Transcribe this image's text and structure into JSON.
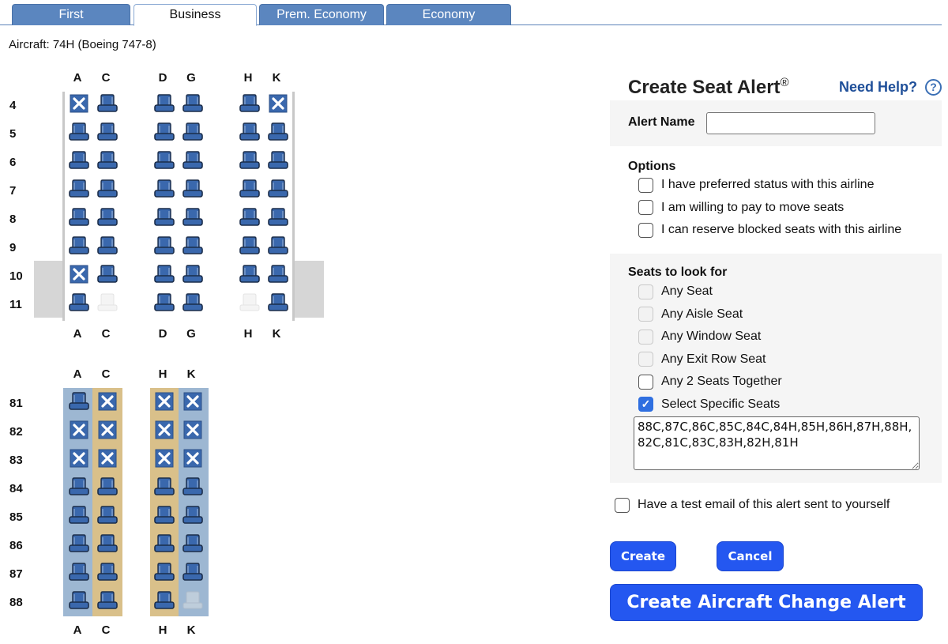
{
  "tabs": [
    {
      "label": "First",
      "active": false
    },
    {
      "label": "Business",
      "active": true
    },
    {
      "label": "Prem. Economy",
      "active": false
    },
    {
      "label": "Economy",
      "active": false
    }
  ],
  "aircraft_label": "Aircraft: 74H (Boeing 747-8)",
  "seatmap": {
    "upper_deck": {
      "columns": [
        "A",
        "C",
        "D",
        "G",
        "H",
        "K"
      ],
      "rows": [
        {
          "row": "4",
          "seats": [
            "blocked",
            "available",
            "available",
            "available",
            "available",
            "blocked"
          ]
        },
        {
          "row": "5",
          "seats": [
            "available",
            "available",
            "available",
            "available",
            "available",
            "available"
          ]
        },
        {
          "row": "6",
          "seats": [
            "available",
            "available",
            "available",
            "available",
            "available",
            "available"
          ]
        },
        {
          "row": "7",
          "seats": [
            "available",
            "available",
            "available",
            "available",
            "available",
            "available"
          ]
        },
        {
          "row": "8",
          "seats": [
            "available",
            "available",
            "available",
            "available",
            "available",
            "available"
          ]
        },
        {
          "row": "9",
          "seats": [
            "available",
            "available",
            "available",
            "available",
            "available",
            "available"
          ]
        },
        {
          "row": "10",
          "seats": [
            "blocked",
            "available",
            "available",
            "available",
            "available",
            "available"
          ]
        },
        {
          "row": "11",
          "seats": [
            "available",
            "empty",
            "available",
            "available",
            "empty",
            "available"
          ]
        }
      ],
      "exit_rows": [
        "10",
        "11"
      ]
    },
    "lower_deck": {
      "columns": [
        "A",
        "C",
        "H",
        "K"
      ],
      "rows": [
        {
          "row": "81",
          "seats": [
            "available",
            "blocked",
            "blocked",
            "blocked"
          ]
        },
        {
          "row": "82",
          "seats": [
            "blocked",
            "blocked",
            "blocked",
            "blocked"
          ]
        },
        {
          "row": "83",
          "seats": [
            "blocked",
            "blocked",
            "blocked",
            "blocked"
          ]
        },
        {
          "row": "84",
          "seats": [
            "available",
            "available",
            "available",
            "available"
          ]
        },
        {
          "row": "85",
          "seats": [
            "available",
            "available",
            "available",
            "available"
          ]
        },
        {
          "row": "86",
          "seats": [
            "available",
            "available",
            "available",
            "available"
          ]
        },
        {
          "row": "87",
          "seats": [
            "available",
            "available",
            "available",
            "available"
          ]
        },
        {
          "row": "88",
          "seats": [
            "available",
            "available",
            "available",
            "empty"
          ]
        }
      ],
      "column_highlights": [
        "window",
        "aisle",
        "aisle",
        "window"
      ]
    },
    "colors": {
      "seat": "#3a68ad",
      "seat_dark": "#1b2d4a",
      "window_band": "#9db7d2",
      "aisle_band": "#d9c08a",
      "exit": "#d6d6d6"
    }
  },
  "panel": {
    "title": "Create Seat Alert",
    "title_mark": "®",
    "help_label": "Need Help?",
    "help_icon": "?",
    "alert_name_label": "Alert Name",
    "alert_name_value": "",
    "options_label": "Options",
    "options": [
      {
        "label": "I have preferred status with this airline",
        "checked": false,
        "disabled": false
      },
      {
        "label": "I am willing to pay to move seats",
        "checked": false,
        "disabled": false
      },
      {
        "label": "I can reserve blocked seats with this airline",
        "checked": false,
        "disabled": false
      }
    ],
    "seats_label": "Seats to look for",
    "seat_options": [
      {
        "label": "Any Seat",
        "checked": false,
        "disabled": true
      },
      {
        "label": "Any Aisle Seat",
        "checked": false,
        "disabled": true
      },
      {
        "label": "Any Window Seat",
        "checked": false,
        "disabled": true
      },
      {
        "label": "Any Exit Row Seat",
        "checked": false,
        "disabled": true
      },
      {
        "label": "Any 2 Seats Together",
        "checked": false,
        "disabled": false
      },
      {
        "label": "Select Specific Seats",
        "checked": true,
        "disabled": false
      }
    ],
    "specific_seats": "88C,87C,86C,85C,84C,84H,85H,86H,87H,88H,82C,81C,83C,83H,82H,81H",
    "test_email_label": "Have a test email of this alert sent to yourself",
    "test_email_checked": false,
    "create_label": "Create",
    "cancel_label": "Cancel",
    "aircraft_change_label": "Create Aircraft Change Alert"
  }
}
